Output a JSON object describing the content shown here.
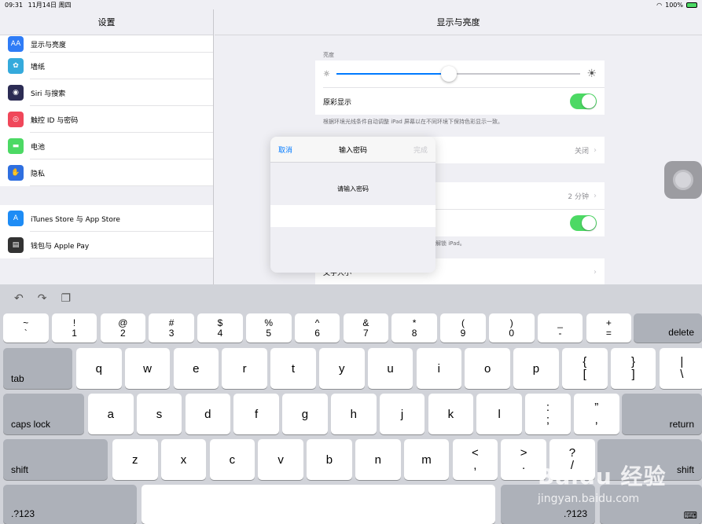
{
  "status": {
    "time": "09:31",
    "date": "11月14日 周四",
    "battery": "100%"
  },
  "sidebar": {
    "title": "设置",
    "items": [
      {
        "label": "显示与亮度",
        "icon": "display-icon",
        "color": "#2f7cf6",
        "glyph": "AA"
      },
      {
        "label": "墙纸",
        "icon": "wallpaper-icon",
        "color": "#35aadc",
        "glyph": "✿"
      },
      {
        "label": "Siri 与搜索",
        "icon": "siri-icon",
        "color": "#2c2c54",
        "glyph": "◉"
      },
      {
        "label": "触控 ID 与密码",
        "icon": "fingerprint-icon",
        "color": "#f0475a",
        "glyph": "◎"
      },
      {
        "label": "电池",
        "icon": "battery-icon",
        "color": "#4cd964",
        "glyph": "▬"
      },
      {
        "label": "隐私",
        "icon": "privacy-hand-icon",
        "color": "#2f6fe0",
        "glyph": "✋"
      },
      {
        "label": "iTunes Store 与 App Store",
        "icon": "app-store-icon",
        "color": "#1e8cf5",
        "glyph": "A"
      },
      {
        "label": "钱包与 Apple Pay",
        "icon": "wallet-icon",
        "color": "#333333",
        "glyph": "▤"
      }
    ]
  },
  "detail": {
    "title": "显示与亮度",
    "brightness_label": "亮度",
    "brightness_level": 0.46,
    "true_tone_label": "原彩显示",
    "true_tone_note": "根据环境光线条件自动调整 iPad 屏幕以在不同环境下保持色彩显示一致。",
    "night_shift_value": "关闭",
    "auto_lock_value": "2 分钟",
    "lock_note": "解锁 iPad。",
    "text_size_label": "文字大小"
  },
  "modal": {
    "cancel": "取消",
    "title": "输入密码",
    "done": "完成",
    "prompt": "请输入密码"
  },
  "keyboard": {
    "number_row": [
      [
        "~",
        "`"
      ],
      [
        "!",
        "1"
      ],
      [
        "@",
        "2"
      ],
      [
        "#",
        "3"
      ],
      [
        "$",
        "4"
      ],
      [
        "%",
        "5"
      ],
      [
        "^",
        "6"
      ],
      [
        "&",
        "7"
      ],
      [
        "*",
        "8"
      ],
      [
        "(",
        "9"
      ],
      [
        ")",
        "0"
      ],
      [
        "_",
        "-"
      ],
      [
        "+",
        "="
      ]
    ],
    "delete": "delete",
    "tab": "tab",
    "row_q": [
      "q",
      "w",
      "e",
      "r",
      "t",
      "y",
      "u",
      "i",
      "o",
      "p"
    ],
    "row_q_sym": [
      [
        "{",
        "["
      ],
      [
        "}",
        "]"
      ],
      [
        "|",
        "\\"
      ]
    ],
    "caps": "caps lock",
    "row_a": [
      "a",
      "s",
      "d",
      "f",
      "g",
      "h",
      "j",
      "k",
      "l"
    ],
    "row_a_sym": [
      [
        ":",
        ";"
      ],
      [
        "”",
        ","
      ]
    ],
    "return": "return",
    "shift": "shift",
    "row_z": [
      "z",
      "x",
      "c",
      "v",
      "b",
      "n",
      "m"
    ],
    "row_z_sym": [
      [
        "<",
        ","
      ],
      [
        ">",
        "."
      ],
      [
        "?",
        "/"
      ]
    ],
    "numbers": ".?123"
  },
  "watermark": {
    "brand": "Baidu 经验",
    "url": "jingyan.baidu.com"
  }
}
